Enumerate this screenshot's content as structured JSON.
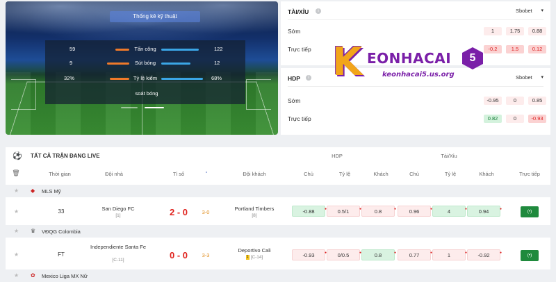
{
  "stadium": {
    "title": "Thống kê kỹ thuật",
    "stats": [
      {
        "label": "Tấn công",
        "home": "59",
        "away": "122",
        "home_share": 0.33,
        "away_share": 0.67
      },
      {
        "label": "Sút bóng",
        "home": "9",
        "away": "12",
        "home_share": 0.43,
        "away_share": 0.57
      },
      {
        "label": "Tỷ lệ kiểm",
        "home": "32%",
        "away": "68%",
        "home_share": 0.32,
        "away_share": 0.68
      }
    ],
    "extra_label": "soát bóng",
    "colors": {
      "home": "#f07a2a",
      "away": "#3ba6e6"
    }
  },
  "taixiu_panel": {
    "title": "TÀI/XỈU",
    "bookmaker": "Sbobet",
    "rows": [
      {
        "label": "Sớm",
        "values": [
          "1",
          "1.75",
          "0.88"
        ]
      },
      {
        "label": "Trực tiếp",
        "values": [
          "-0.2",
          "1.5",
          "0.12"
        ]
      }
    ]
  },
  "hdp_panel": {
    "title": "HDP",
    "bookmaker": "Sbobet",
    "rows": [
      {
        "label": "Sớm",
        "values": [
          "-0.95",
          "0",
          "0.85"
        ]
      },
      {
        "label": "Trực tiếp",
        "values": [
          "0.82",
          "0",
          "-0.93"
        ]
      }
    ]
  },
  "watermark": {
    "letter": "K",
    "word": "EONHACAI",
    "badge": "5",
    "url": "keonhacai5.us.org"
  },
  "live": {
    "title": "TẤT CẢ TRẬN ĐANG LIVE",
    "group_headers": {
      "hdp": "HDP",
      "taixiu": "Tài/Xỉu"
    },
    "columns": {
      "time": "Thời gian",
      "home": "Đội nhà",
      "score": "Tỉ số",
      "away": "Đội khách",
      "hdp_home": "Chủ",
      "hdp_rate": "Tỷ lệ",
      "hdp_away": "Khách",
      "tx_home": "Chủ",
      "tx_rate": "Tỷ lệ",
      "tx_away": "Khách",
      "live": "Trực tiếp"
    },
    "leagues": [
      {
        "name": "MLS Mỹ",
        "match": {
          "time": "33",
          "home": "San Diego FC",
          "home_rank": "[1]",
          "score": "2 - 0",
          "ht": "3-0",
          "away": "Portland Timbers",
          "away_rank": "[8]",
          "odds": [
            "-0.88",
            "0.5/1",
            "0.8",
            "0.96",
            "4",
            "0.94"
          ]
        }
      },
      {
        "name": "VĐQG Colombia",
        "match": {
          "time": "FT",
          "home": "Independiente Santa Fe",
          "home_rank": "[C-11]",
          "score": "0 - 0",
          "ht": "3-3",
          "away": "Deportivo Cali",
          "away_rank": "[C-14]",
          "away_card": "1",
          "odds": [
            "-0.93",
            "0/0.5",
            "0.8",
            "0.77",
            "1",
            "-0.92"
          ]
        }
      },
      {
        "name": "Mexico Liga MX Nữ"
      }
    ],
    "live_button": "(•)"
  }
}
